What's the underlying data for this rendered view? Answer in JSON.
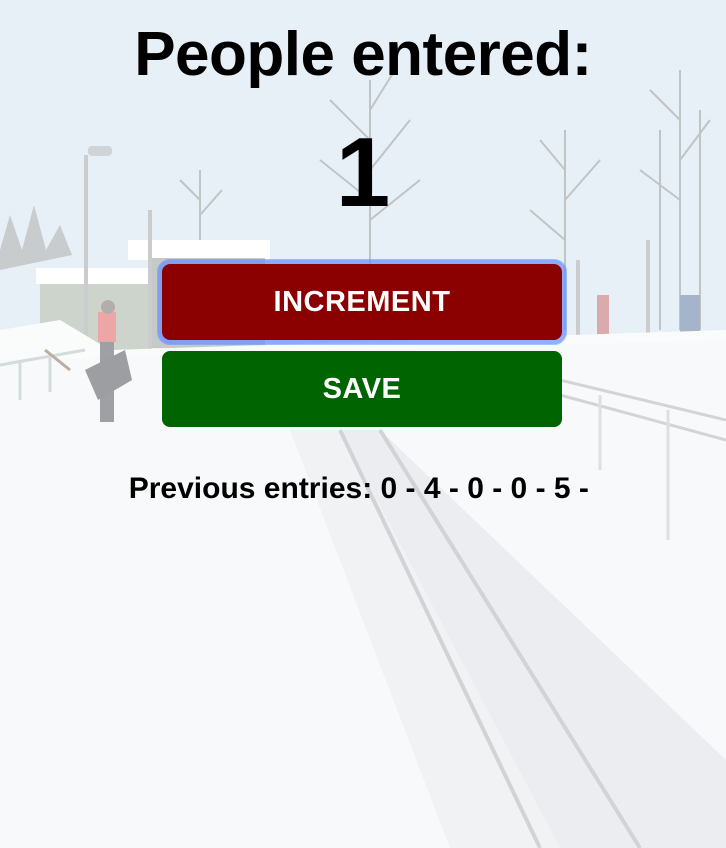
{
  "header": {
    "title": "People entered:"
  },
  "counter": {
    "value": "1"
  },
  "actions": {
    "increment_label": "INCREMENT",
    "save_label": "SAVE"
  },
  "history": {
    "label": "Previous entries: ",
    "entries": "0 - 4 - 0 - 0 - 5 - "
  },
  "colors": {
    "increment_button": "#8b0000",
    "save_button": "#006400",
    "text": "#000000"
  }
}
